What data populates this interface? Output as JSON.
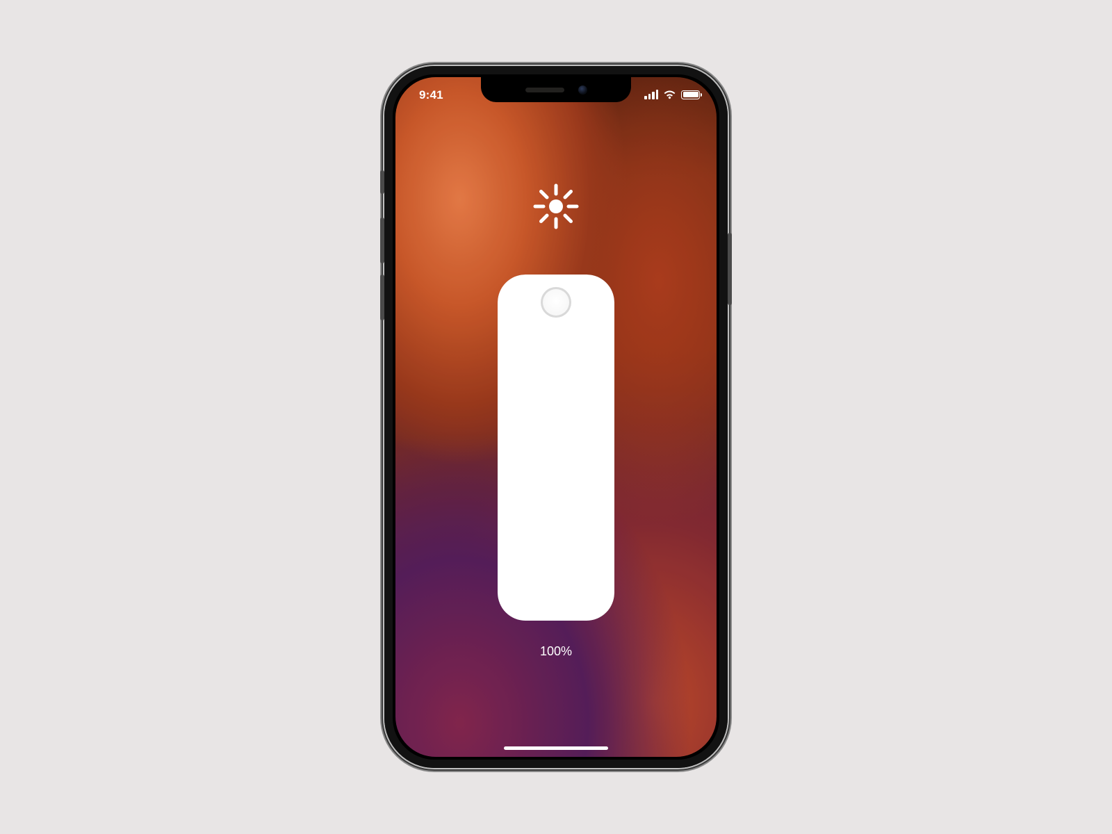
{
  "status_bar": {
    "time": "9:41",
    "icons": {
      "signal": "signal-icon",
      "wifi": "wifi-icon",
      "battery": "battery-icon"
    }
  },
  "brightness": {
    "icon": "brightness-icon",
    "value_percent": 100,
    "label": "100%"
  }
}
